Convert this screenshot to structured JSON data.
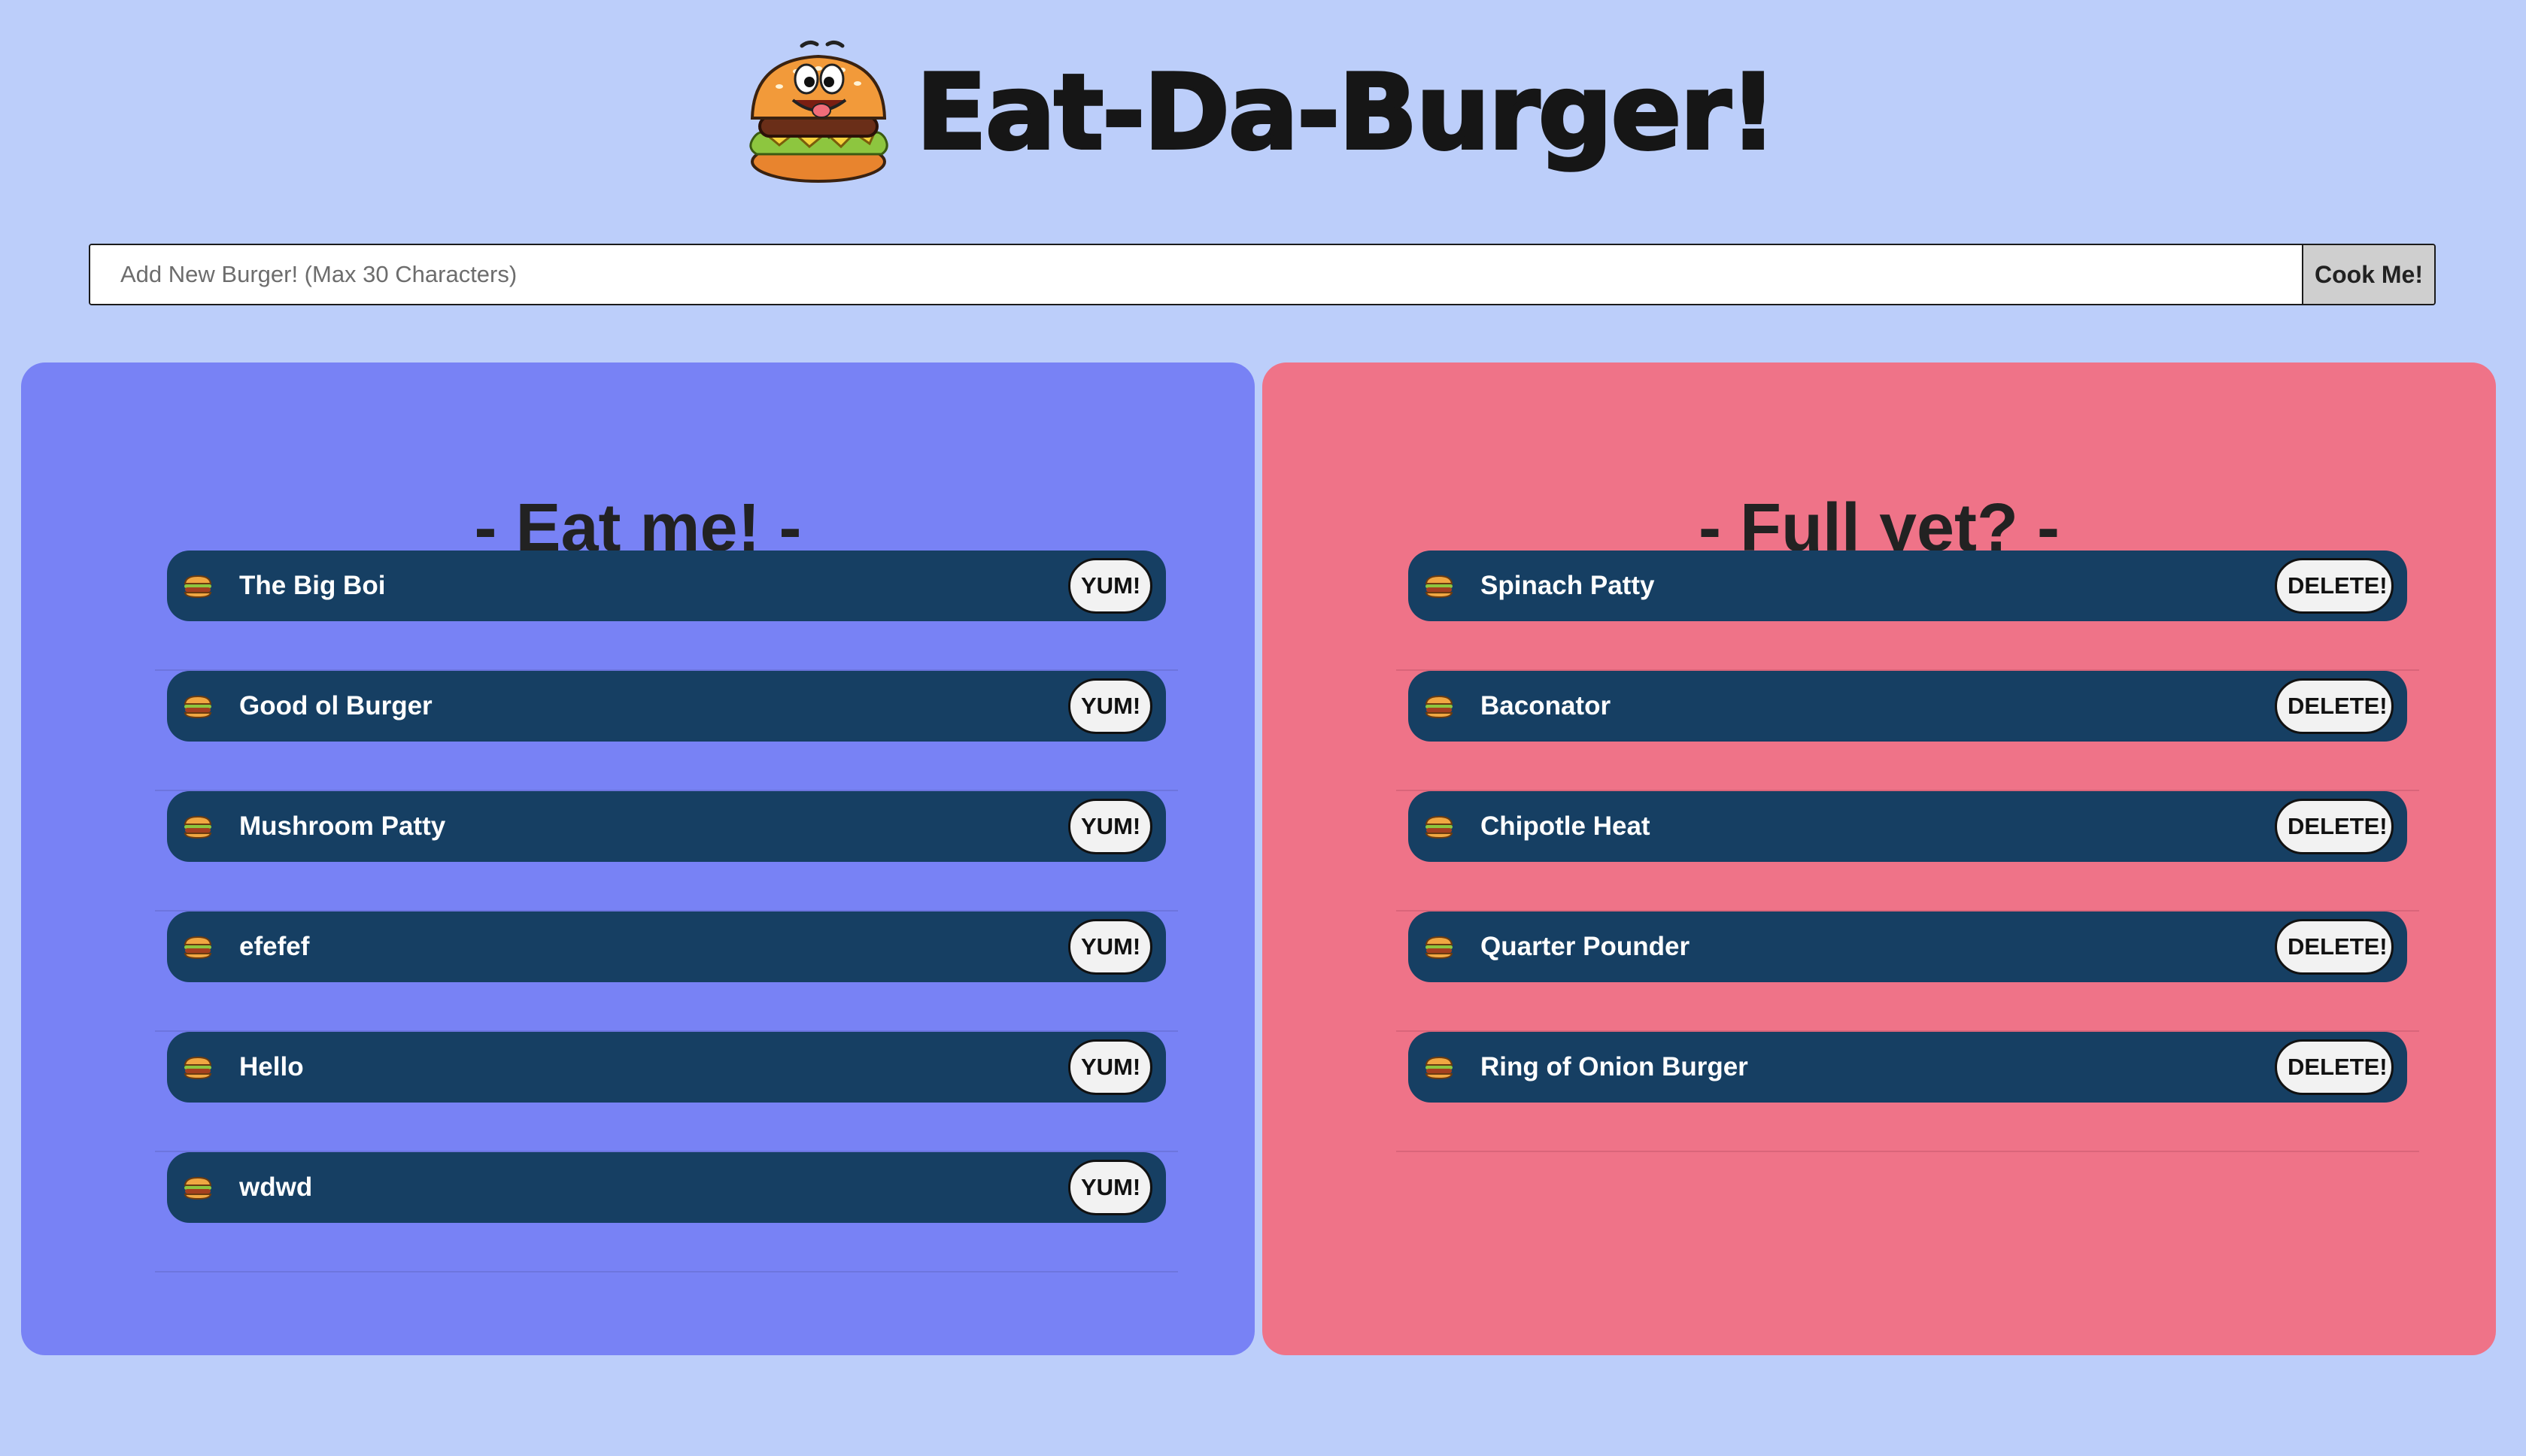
{
  "header": {
    "title": "Eat-Da-Burger!",
    "logo_icon": "burger-mascot-icon"
  },
  "form": {
    "placeholder": "Add New Burger! (Max 30 Characters)",
    "value": "",
    "submit_label": "Cook Me!"
  },
  "eat_panel": {
    "title": "- Eat me! -",
    "button_label": "YUM!",
    "item_icon": "burger-icon",
    "items": [
      {
        "name": "The Big Boi"
      },
      {
        "name": "Good ol Burger"
      },
      {
        "name": "Mushroom Patty"
      },
      {
        "name": "efefef"
      },
      {
        "name": "Hello"
      },
      {
        "name": "wdwd"
      }
    ]
  },
  "full_panel": {
    "title": "- Full yet? -",
    "button_label": "DELETE!",
    "item_icon": "burger-icon",
    "items": [
      {
        "name": "Spinach Patty"
      },
      {
        "name": "Baconator"
      },
      {
        "name": "Chipotle Heat"
      },
      {
        "name": "Quarter Pounder"
      },
      {
        "name": "Ring of Onion Burger"
      }
    ]
  },
  "colors": {
    "page_background": "#bccefa",
    "eat_panel": "#7882f5",
    "full_panel": "#ef7388",
    "item_pill": "#163f63",
    "button": "#f2f2f2"
  }
}
